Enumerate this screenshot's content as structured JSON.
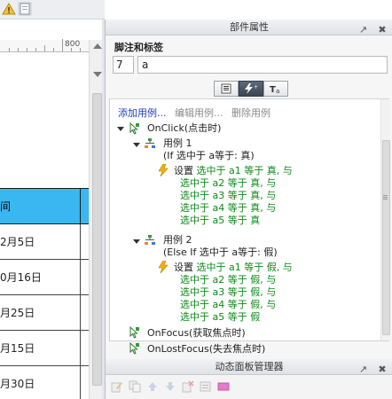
{
  "ruler": {
    "label": "800"
  },
  "table": {
    "header": "间",
    "rows": [
      "2月5日",
      "0月16日",
      "月25日",
      "月15日",
      "月30日"
    ]
  },
  "panel": {
    "title": "部件属性",
    "section_label": "脚注和标签",
    "footnote_number": "7",
    "label_value": "a",
    "tabs": [
      "properties-tab",
      "interactions-tab",
      "text-tab"
    ],
    "actions": {
      "add": "添加用例...",
      "edit": "编辑用例...",
      "delete": "删除用例"
    },
    "tree": {
      "onclick": "OnClick(点击时)",
      "case1": "用例 1",
      "case1_cond": "(If 选中于 a等于: 真)",
      "case1_set": "设置",
      "case1_lines": [
        "选中于 a1 等于 真, 与",
        "选中于 a2 等于 真, 与",
        "选中于 a3 等于 真, 与",
        "选中于 a4 等于 真, 与",
        "选中于 a5 等于 真"
      ],
      "case2": "用例 2",
      "case2_cond": "(Else If 选中于 a等于: 假)",
      "case2_set": "设置",
      "case2_lines": [
        "选中于 a1 等于 假, 与",
        "选中于 a2 等于 假, 与",
        "选中于 a3 等于 假, 与",
        "选中于 a4 等于 假, 与",
        "选中于 a5 等于 假"
      ],
      "onfocus": "OnFocus(获取焦点时)",
      "onlostfocus": "OnLostFocus(失去焦点时)"
    },
    "title_icons": {
      "pin": "↗",
      "close": "✖"
    }
  },
  "dynamic_panel": {
    "title": "动态面板管理器"
  },
  "colors": {
    "table_header": "#39b7f0",
    "action_green": "#0c8a1a",
    "link_blue": "#1a3cc4"
  }
}
